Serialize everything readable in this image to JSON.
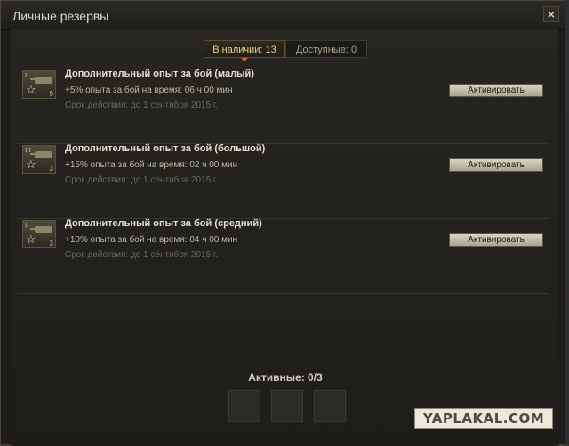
{
  "window": {
    "title": "Личные резервы",
    "close_glyph": "×"
  },
  "tabs": [
    {
      "label": "В наличии: 13",
      "active": true
    },
    {
      "label": "Доступные: 0",
      "active": false
    }
  ],
  "reserves": [
    {
      "tier": "I",
      "count": "9",
      "title": "Дополнительный опыт за бой (малый)",
      "bonus": "+5% опыта за бой на время: 06 ч 00 мин",
      "expiry": "Срок действия: до 1 сентября 2015 г.",
      "button": "Активировать",
      "icon": "tank-icon"
    },
    {
      "tier": "III",
      "count": "3",
      "title": "Дополнительный опыт за бой (большой)",
      "bonus": "+15% опыта за бой на время: 02 ч 00 мин",
      "expiry": "Срок действия: до 1 сентября 2015 г.",
      "button": "Активировать",
      "icon": "tank-icon"
    },
    {
      "tier": "II",
      "count": "3",
      "title": "Дополнительный опыт за бой (средний)",
      "bonus": "+10% опыта за бой на время: 04 ч 00 мин",
      "expiry": "Срок действия: до 1 сентября 2015 г.",
      "button": "Активировать",
      "icon": "tank-icon"
    }
  ],
  "active": {
    "label": "Активные: 0/3",
    "slots": 3
  },
  "watermark": "YAPLAKAL.COM",
  "colors": {
    "active_tab_text": "#e8cf8a",
    "tab_indicator": "#e0622a"
  }
}
